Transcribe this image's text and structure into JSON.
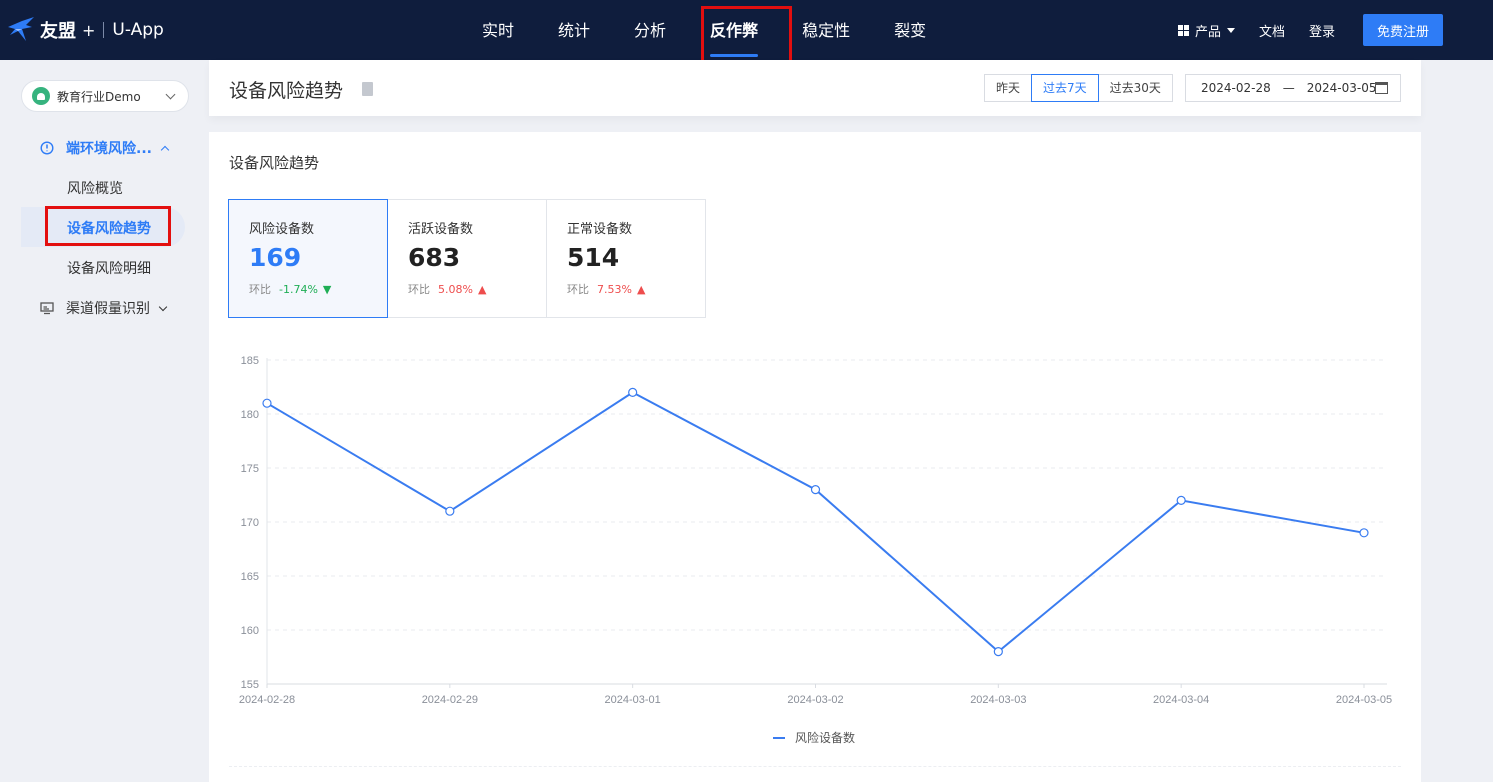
{
  "topbar": {
    "brand": "友盟",
    "brand_plus": "+",
    "app_name": "U-App",
    "nav": [
      {
        "label": "实时"
      },
      {
        "label": "统计"
      },
      {
        "label": "分析"
      },
      {
        "label": "反作弊",
        "active": true
      },
      {
        "label": "稳定性"
      },
      {
        "label": "裂变"
      }
    ],
    "products_label": "产品",
    "docs_label": "文档",
    "login_label": "登录",
    "register_label": "免费注册"
  },
  "sidebar": {
    "app_selector": "教育行业Demo",
    "groups": [
      {
        "label": "端环境风险...",
        "expanded": true,
        "icon": "risk-shield-icon",
        "items": [
          {
            "label": "风险概览"
          },
          {
            "label": "设备风险趋势",
            "active": true
          },
          {
            "label": "设备风险明细"
          }
        ]
      },
      {
        "label": "渠道假量识别",
        "expanded": false,
        "icon": "monitor-icon"
      }
    ]
  },
  "header": {
    "title": "设备风险趋势",
    "ranges": [
      "昨天",
      "过去7天",
      "过去30天"
    ],
    "active_range": "过去7天",
    "date_start": "2024-02-28",
    "date_sep": "—",
    "date_end": "2024-03-05"
  },
  "card": {
    "title": "设备风险趋势",
    "kpis": [
      {
        "label": "风险设备数",
        "value": "169",
        "change_label": "环比",
        "change": "-1.74%",
        "direction": "down",
        "active": true
      },
      {
        "label": "活跃设备数",
        "value": "683",
        "change_label": "环比",
        "change": "5.08%",
        "direction": "up"
      },
      {
        "label": "正常设备数",
        "value": "514",
        "change_label": "环比",
        "change": "7.53%",
        "direction": "up"
      }
    ]
  },
  "colors": {
    "nav_bg": "#0f1d3d",
    "accent": "#2e7cf6",
    "up": "#ee4d4d",
    "down": "#1fae55",
    "highlight": "#e30f0f"
  },
  "chart_data": {
    "type": "line",
    "x": [
      "2024-02-28",
      "2024-02-29",
      "2024-03-01",
      "2024-03-02",
      "2024-03-03",
      "2024-03-04",
      "2024-03-05"
    ],
    "series": [
      {
        "name": "风险设备数",
        "values": [
          181,
          171,
          182,
          173,
          158,
          172,
          169
        ],
        "color": "#3a7cf0"
      }
    ],
    "yticks": [
      155,
      160,
      165,
      170,
      175,
      180,
      185
    ],
    "ylim": [
      155,
      185
    ],
    "grid": true,
    "legend": "bottom-center"
  }
}
